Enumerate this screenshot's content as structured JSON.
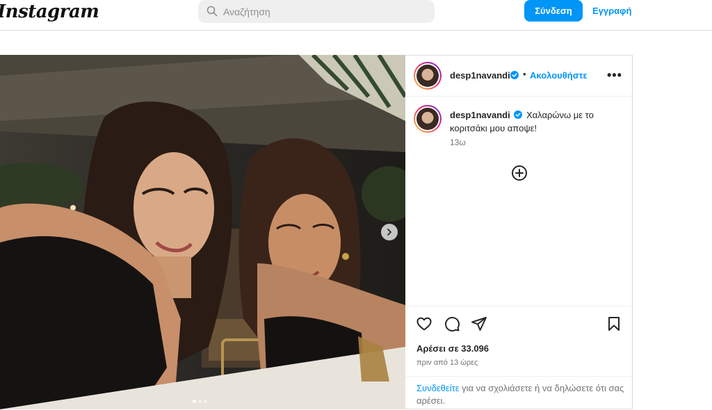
{
  "header": {
    "logo": "Instagram",
    "search_placeholder": "Αναζήτηση",
    "login_label": "Σύνδεση",
    "signup_label": "Εγγραφή"
  },
  "post": {
    "username": "desp1navandi",
    "separator": "•",
    "follow_label": "Ακολουθήστε",
    "more_label": "•••",
    "caption_username": "desp1navandi",
    "caption": "Χαλαρώνω με το κοριτσάκι μου αποψε!",
    "caption_time": "13ω",
    "likes": "Αρέσει σε 33.096",
    "time_ago": "πριν από 13 ώρες",
    "login_prompt_link": "Συνδεθείτε",
    "login_prompt_rest": " για να σχολιάσετε ή να δηλώσετε ότι σας αρέσει.",
    "carousel": {
      "slides": 3,
      "active_slide": 1
    }
  },
  "colors": {
    "accent": "#0095f6",
    "border": "#dbdbdb",
    "muted_text": "#737373"
  },
  "icons": [
    "search-icon",
    "verified-badge-icon",
    "more-options-icon",
    "add-circle-icon",
    "heart-icon",
    "comment-icon",
    "share-icon",
    "bookmark-icon",
    "chevron-right-icon"
  ]
}
